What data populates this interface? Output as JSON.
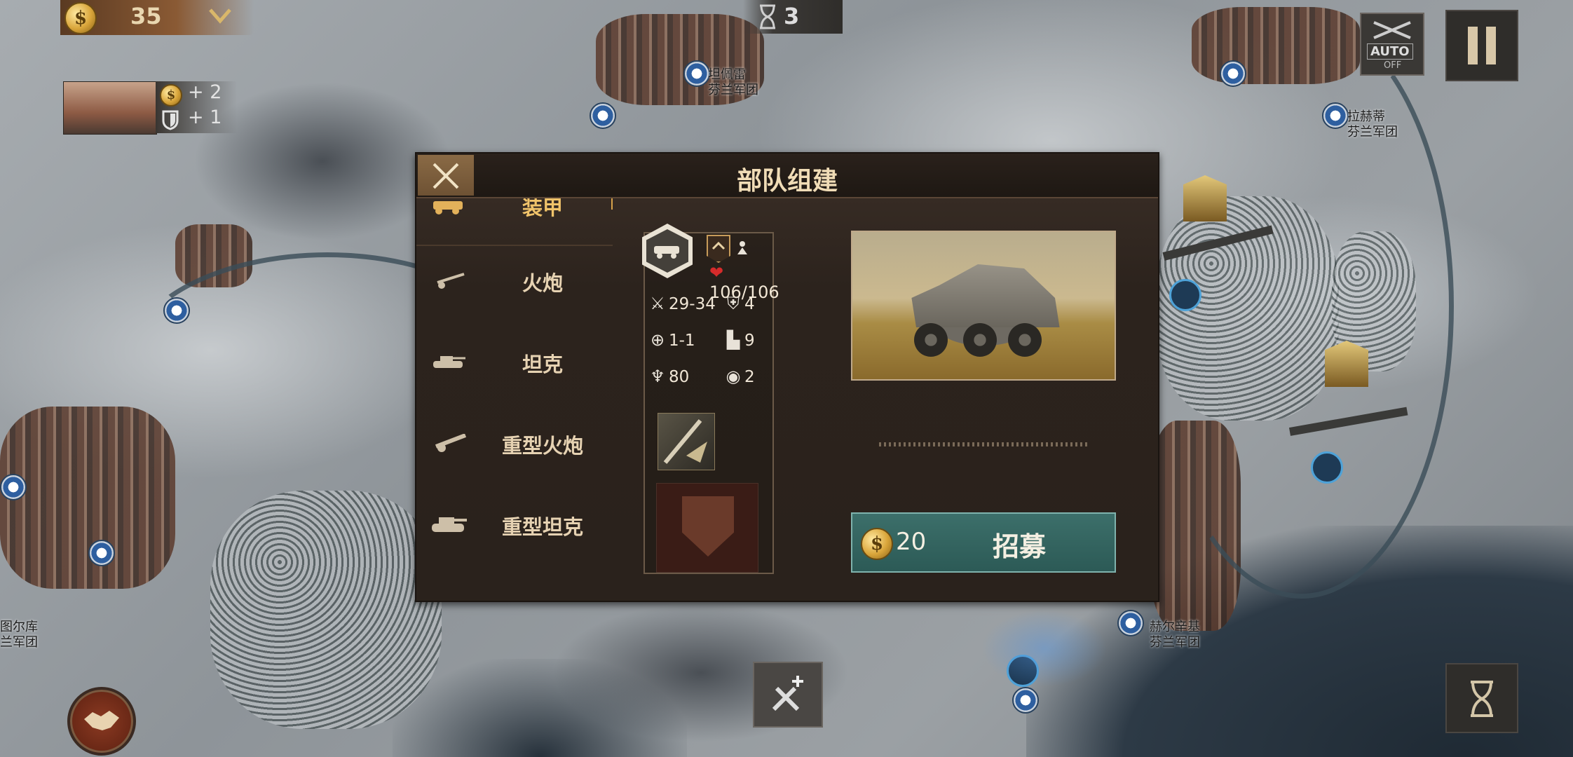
{
  "hud": {
    "gold": "35",
    "turns_left": "3",
    "income_gold": "+ 2",
    "income_defense": "+ 1",
    "auto_label": "AUTO",
    "auto_state": "OFF"
  },
  "map_labels": [
    {
      "name": "坦佩雷",
      "sub": "芬兰军团"
    },
    {
      "name": "拉赫蒂",
      "sub": "芬兰军团"
    },
    {
      "name": "图尔库",
      "sub": "兰军团"
    },
    {
      "name": "赫尔辛基",
      "sub": "芬兰军团"
    }
  ],
  "dialog": {
    "title": "部队组建",
    "categories": [
      {
        "label": "装甲",
        "icon": "armored-car-icon",
        "selected": true
      },
      {
        "label": "火炮",
        "icon": "artillery-icon",
        "selected": false
      },
      {
        "label": "坦克",
        "icon": "tank-icon",
        "selected": false
      },
      {
        "label": "重型火炮",
        "icon": "heavy-artillery-icon",
        "selected": false
      },
      {
        "label": "重型坦克",
        "icon": "heavy-tank-icon",
        "selected": false
      }
    ],
    "unit": {
      "hp": "106/106",
      "attack": "29-34",
      "defense": "4",
      "range": "1-1",
      "movement": "9",
      "organization": "80",
      "vision": "2"
    },
    "recruit": {
      "price": "20",
      "label": "招募"
    }
  },
  "colors": {
    "dialog_bg": "#2c231d",
    "title_text": "#f0dcb6",
    "recruit_button": "#3c6f6a",
    "hp_heart": "#d62b2b",
    "selected_tab_accent": "#d7a24a"
  }
}
